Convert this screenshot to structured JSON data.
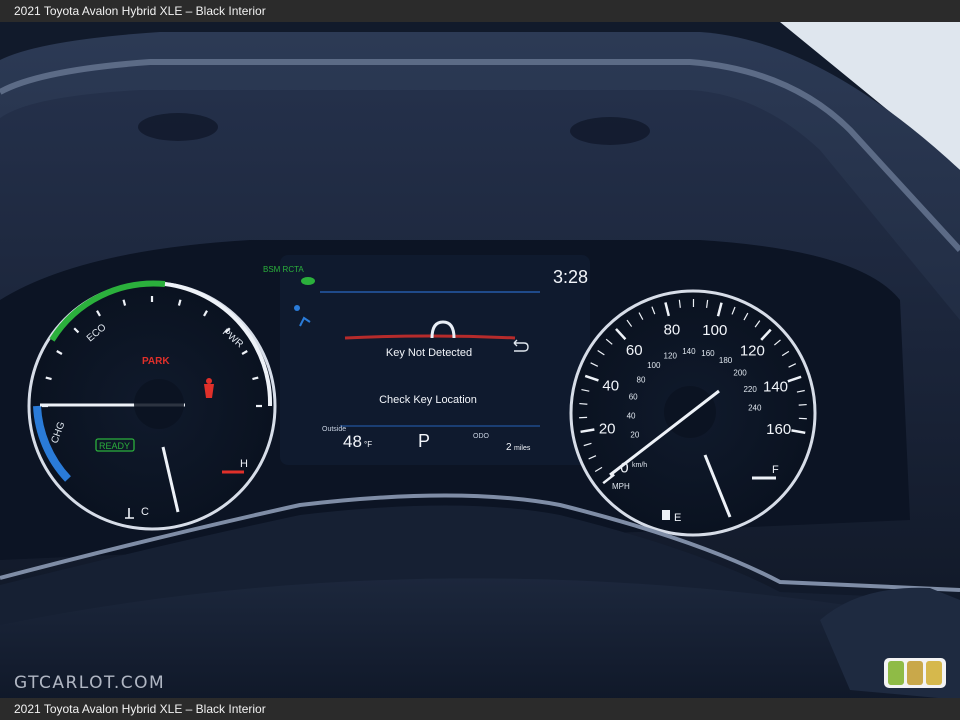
{
  "caption": {
    "top": "2021 Toyota Avalon Hybrid XLE – Black Interior",
    "bottom": "2021 Toyota Avalon Hybrid XLE – Black Interior"
  },
  "watermark": "GTCARLOT.COM",
  "cluster": {
    "center": {
      "indicators": "BSM RCTA",
      "clock": "3:28",
      "message_title": "Key Not Detected",
      "message_body": "Check Key Location",
      "outside_label": "Outside",
      "outside_temp": "48",
      "temp_unit": "°F",
      "gear": "P",
      "odo_label": "ODO",
      "odo_value": "2",
      "odo_unit": "miles"
    },
    "left_gauge": {
      "eco": "ECO",
      "pwr": "PWR",
      "chg": "CHG",
      "park": "PARK",
      "ready": "READY",
      "hot": "H",
      "cold": "C"
    },
    "speedometer": {
      "mph_labels": [
        "0",
        "20",
        "40",
        "60",
        "80",
        "100",
        "120",
        "140",
        "160"
      ],
      "kmh_labels": [
        "20",
        "40",
        "60",
        "80",
        "100",
        "120",
        "140",
        "160",
        "180",
        "200",
        "220",
        "240"
      ],
      "kmh_unit": "km/h",
      "mph_unit": "MPH",
      "speed_mph": 0,
      "fuel_full": "F",
      "fuel_empty": "E",
      "fuel_level": 0.75
    }
  },
  "colors": {
    "screen": "#0f1a2e",
    "bezel": "#1c2536",
    "accent_blue": "#2a7bd8",
    "eco_green": "#2bb03c",
    "warn_red": "#e0302a"
  }
}
